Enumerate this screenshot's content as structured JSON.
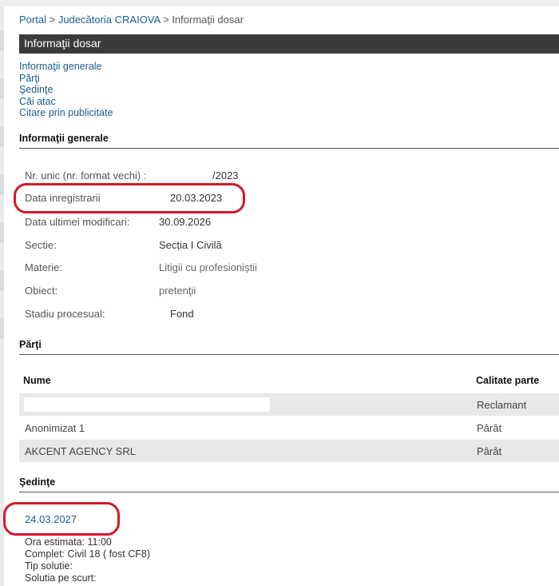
{
  "breadcrumb": {
    "portal": "Portal",
    "sep1": ">",
    "court": "Judecătoria CRAIOVA",
    "sep2": ">",
    "current": "Informaţii dosar"
  },
  "title": "Informaţii dosar",
  "nav": [
    "Informaţii generale",
    "Părţi",
    "Şedinţe",
    "Căi atac",
    "Citare prin publicitate"
  ],
  "general": {
    "heading": "Informaţii generale",
    "fields": [
      {
        "label": "Nr. unic (nr. format vechi) :",
        "value": "/2023"
      },
      {
        "label": "Data inregistrarii",
        "value": "20.03.2023"
      },
      {
        "label": "Data ultimei modificari:",
        "value": "30.09.2026"
      },
      {
        "label": "Sectie:",
        "value": "Secția I Civilă"
      },
      {
        "label": "Materie:",
        "value": "Litigii cu profesioniștii"
      },
      {
        "label": "Obiect:",
        "value": "pretenţii"
      },
      {
        "label": "Stadiu procesual:",
        "value": "Fond"
      }
    ]
  },
  "parti": {
    "heading": "Părţi",
    "columns": [
      "Nume",
      "Calitate parte"
    ],
    "rows": [
      {
        "name": "",
        "role": "Reclamant"
      },
      {
        "name": "Anonimizat 1",
        "role": "Pârât"
      },
      {
        "name": "AKCENT AGENCY SRL",
        "role": "Pârât"
      }
    ]
  },
  "sedinte": {
    "heading": "Şedinţe",
    "date": "24.03.2027",
    "lines": [
      "Ora estimata: 11:00",
      "Complet: Civil 18 ( fost CF8)",
      "Tip solutie:",
      "Solutia pe scurt:"
    ]
  },
  "colors": {
    "title_bg": "#3b3b3b",
    "link": "#1a5d8f",
    "highlight": "#d3182a",
    "row_shade": "#e8e8e8"
  }
}
